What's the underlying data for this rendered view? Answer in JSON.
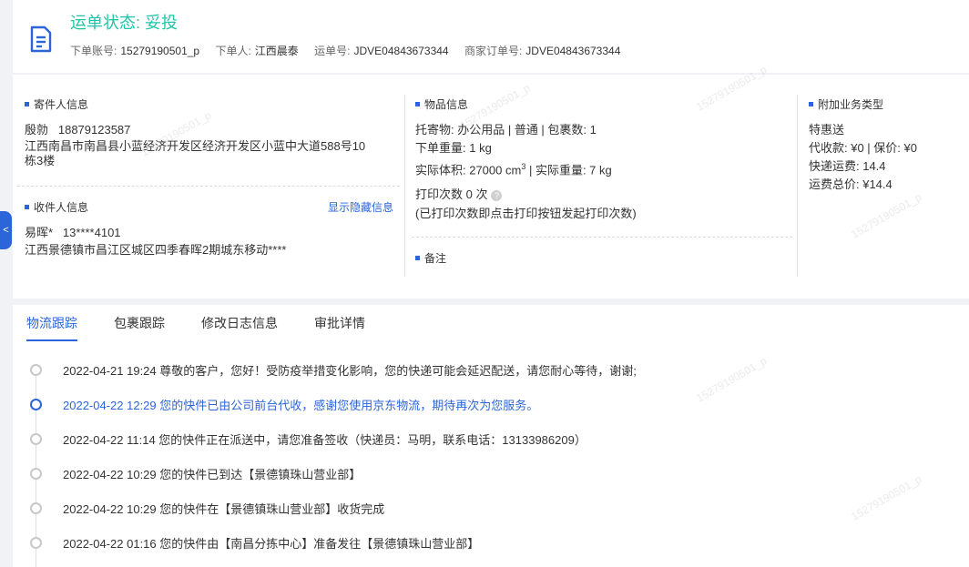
{
  "header": {
    "status": "运单状态: 妥投",
    "account_label": "下单账号:",
    "account": "15279190501_p",
    "orderer_label": "下单人:",
    "orderer": "江西晨泰",
    "waybill_label": "运单号:",
    "waybill": "JDVE04843673344",
    "merchant_label": "商家订单号:",
    "merchant_order": "JDVE04843673344"
  },
  "sender": {
    "title": "寄件人信息",
    "name": "殷勍",
    "phone": "18879123587",
    "address_line1": "江西南昌市南昌县小蓝经济开发区经济开发区小蓝中大道588号10",
    "address_line2": "栋3楼"
  },
  "receiver": {
    "title": "收件人信息",
    "show_hidden": "显示隐藏信息",
    "name": "易晖*",
    "phone": "13****4101",
    "address": "江西景德镇市昌江区城区四季春晖2期城东移动****"
  },
  "goods": {
    "title": "物品信息",
    "line1": "托寄物:  办公用品 | 普通  |  包裹数:  1",
    "order_weight": "下单重量:   1 kg",
    "volume_label": "实际体积:   27000 cm",
    "volume_sup": "3",
    "actual_weight": "|  实际重量:   7 kg",
    "print_count": "打印次数    0 次",
    "print_note": "(已打印次数即点击打印按钮发起打印次数)"
  },
  "remark": {
    "title": "备注"
  },
  "extra": {
    "title": "附加业务类型",
    "type": "特惠送",
    "cod": "代收款:  ¥0  |  保价:  ¥0",
    "freight": "快递运费:   14.4",
    "total": "运费总价:  ¥14.4"
  },
  "side_tab": {
    "icon": "chevron-left-icon",
    "glyph": "<"
  },
  "tabs": [
    {
      "label": "物流跟踪",
      "active": true
    },
    {
      "label": "包裹跟踪",
      "active": false
    },
    {
      "label": "修改日志信息",
      "active": false
    },
    {
      "label": "审批详情",
      "active": false
    }
  ],
  "timeline": [
    {
      "text": "2022-04-21 19:24 尊敬的客户，您好！受防疫举措变化影响，您的快递可能会延迟配送，请您耐心等待，谢谢;",
      "active": false
    },
    {
      "text": "2022-04-22 12:29 您的快件已由公司前台代收，感谢您使用京东物流，期待再次为您服务。",
      "active": true
    },
    {
      "text": "2022-04-22 11:14 您的快件正在派送中，请您准备签收（快递员：马明，联系电话：13133986209）",
      "active": false
    },
    {
      "text": "2022-04-22 10:29 您的快件已到达【景德镇珠山营业部】",
      "active": false
    },
    {
      "text": "2022-04-22 10:29 您的快件在【景德镇珠山营业部】收货完成",
      "active": false
    },
    {
      "text": "2022-04-22 01:16 您的快件由【南昌分拣中心】准备发往【景德镇珠山营业部】",
      "active": false
    }
  ],
  "colors": {
    "accent": "#2b65d9",
    "status": "#22c3a6"
  }
}
